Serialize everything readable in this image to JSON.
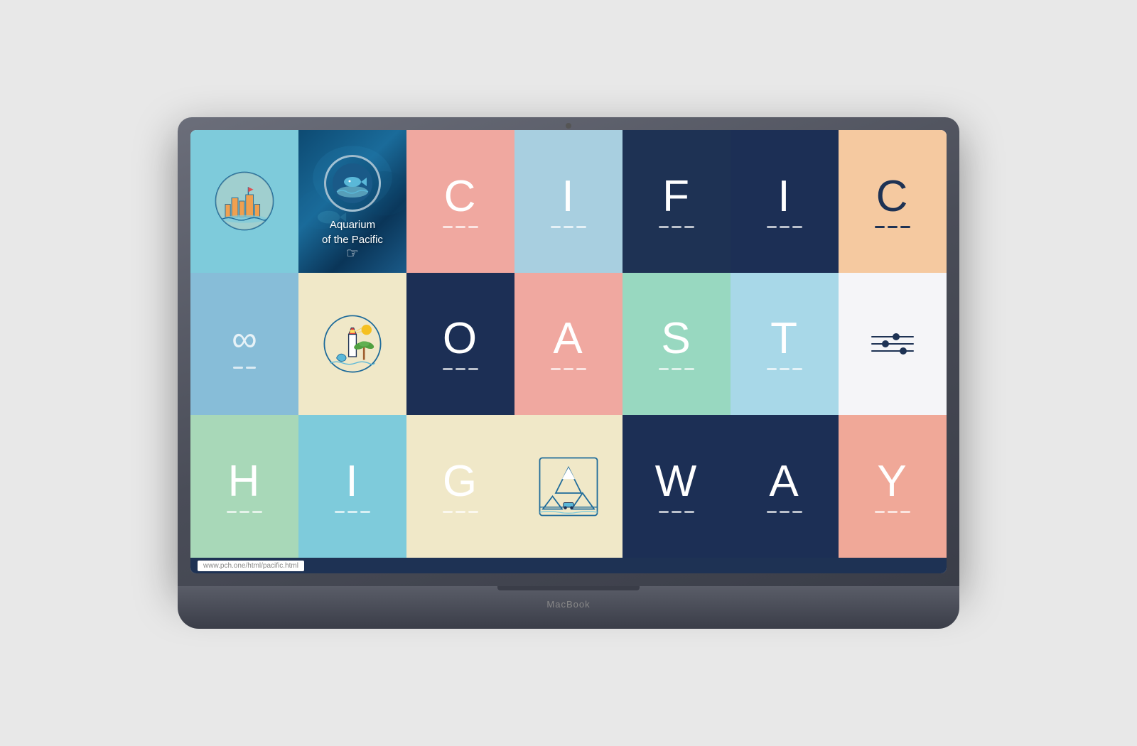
{
  "laptop": {
    "brand": "MacBook",
    "url": "www.pch.one/html/pacific.html"
  },
  "grid": {
    "rows": [
      {
        "cells": [
          {
            "id": "r1c1",
            "type": "illustration",
            "illustration": "city",
            "bg": "skyblue"
          },
          {
            "id": "r1c2",
            "type": "aquarium",
            "text": "Aquarium\nof the Pacific",
            "bg": "oceanblue-photo"
          },
          {
            "id": "r1c3",
            "type": "letter",
            "letter": "C",
            "bg": "salmon"
          },
          {
            "id": "r1c4",
            "type": "letter",
            "letter": "I",
            "bg": "lightblue"
          },
          {
            "id": "r1c5",
            "type": "letter",
            "letter": "F",
            "bg": "navy"
          },
          {
            "id": "r1c6",
            "type": "letter",
            "letter": "I",
            "bg": "navy"
          },
          {
            "id": "r1c7",
            "type": "letter",
            "letter": "C",
            "bg": "peach"
          }
        ]
      },
      {
        "cells": [
          {
            "id": "r2c1",
            "type": "symbol",
            "symbol": "infinity",
            "bg": "lightblue"
          },
          {
            "id": "r2c2",
            "type": "illustration",
            "illustration": "lighthouse",
            "bg": "cream"
          },
          {
            "id": "r2c3",
            "type": "letter",
            "letter": "O",
            "bg": "darknavy"
          },
          {
            "id": "r2c4",
            "type": "letter",
            "letter": "A",
            "bg": "salmon"
          },
          {
            "id": "r2c5",
            "type": "letter",
            "letter": "S",
            "bg": "mint"
          },
          {
            "id": "r2c6",
            "type": "letter",
            "letter": "T",
            "bg": "lightcyan"
          },
          {
            "id": "r2c7",
            "type": "symbol",
            "symbol": "sliders",
            "bg": "white"
          }
        ]
      },
      {
        "cells": [
          {
            "id": "r3c1",
            "type": "letter",
            "letter": "H",
            "bg": "seafoam"
          },
          {
            "id": "r3c2",
            "type": "letter",
            "letter": "I",
            "bg": "lightcyan"
          },
          {
            "id": "r3c3",
            "type": "letter",
            "letter": "G",
            "bg": "cream"
          },
          {
            "id": "r3c4",
            "type": "illustration",
            "illustration": "mountain",
            "bg": "cream"
          },
          {
            "id": "r3c5",
            "type": "letter",
            "letter": "W",
            "bg": "navy"
          },
          {
            "id": "r3c6",
            "type": "letter",
            "letter": "A",
            "bg": "navy"
          },
          {
            "id": "r3c7",
            "type": "letter",
            "letter": "Y",
            "bg": "pinksalmon"
          }
        ]
      }
    ],
    "letters": {
      "row1": [
        "C",
        "I",
        "F",
        "I",
        "C"
      ],
      "row2": [
        "O",
        "A",
        "S",
        "T"
      ],
      "row3": [
        "H",
        "I",
        "G",
        "W",
        "A",
        "Y"
      ]
    }
  }
}
